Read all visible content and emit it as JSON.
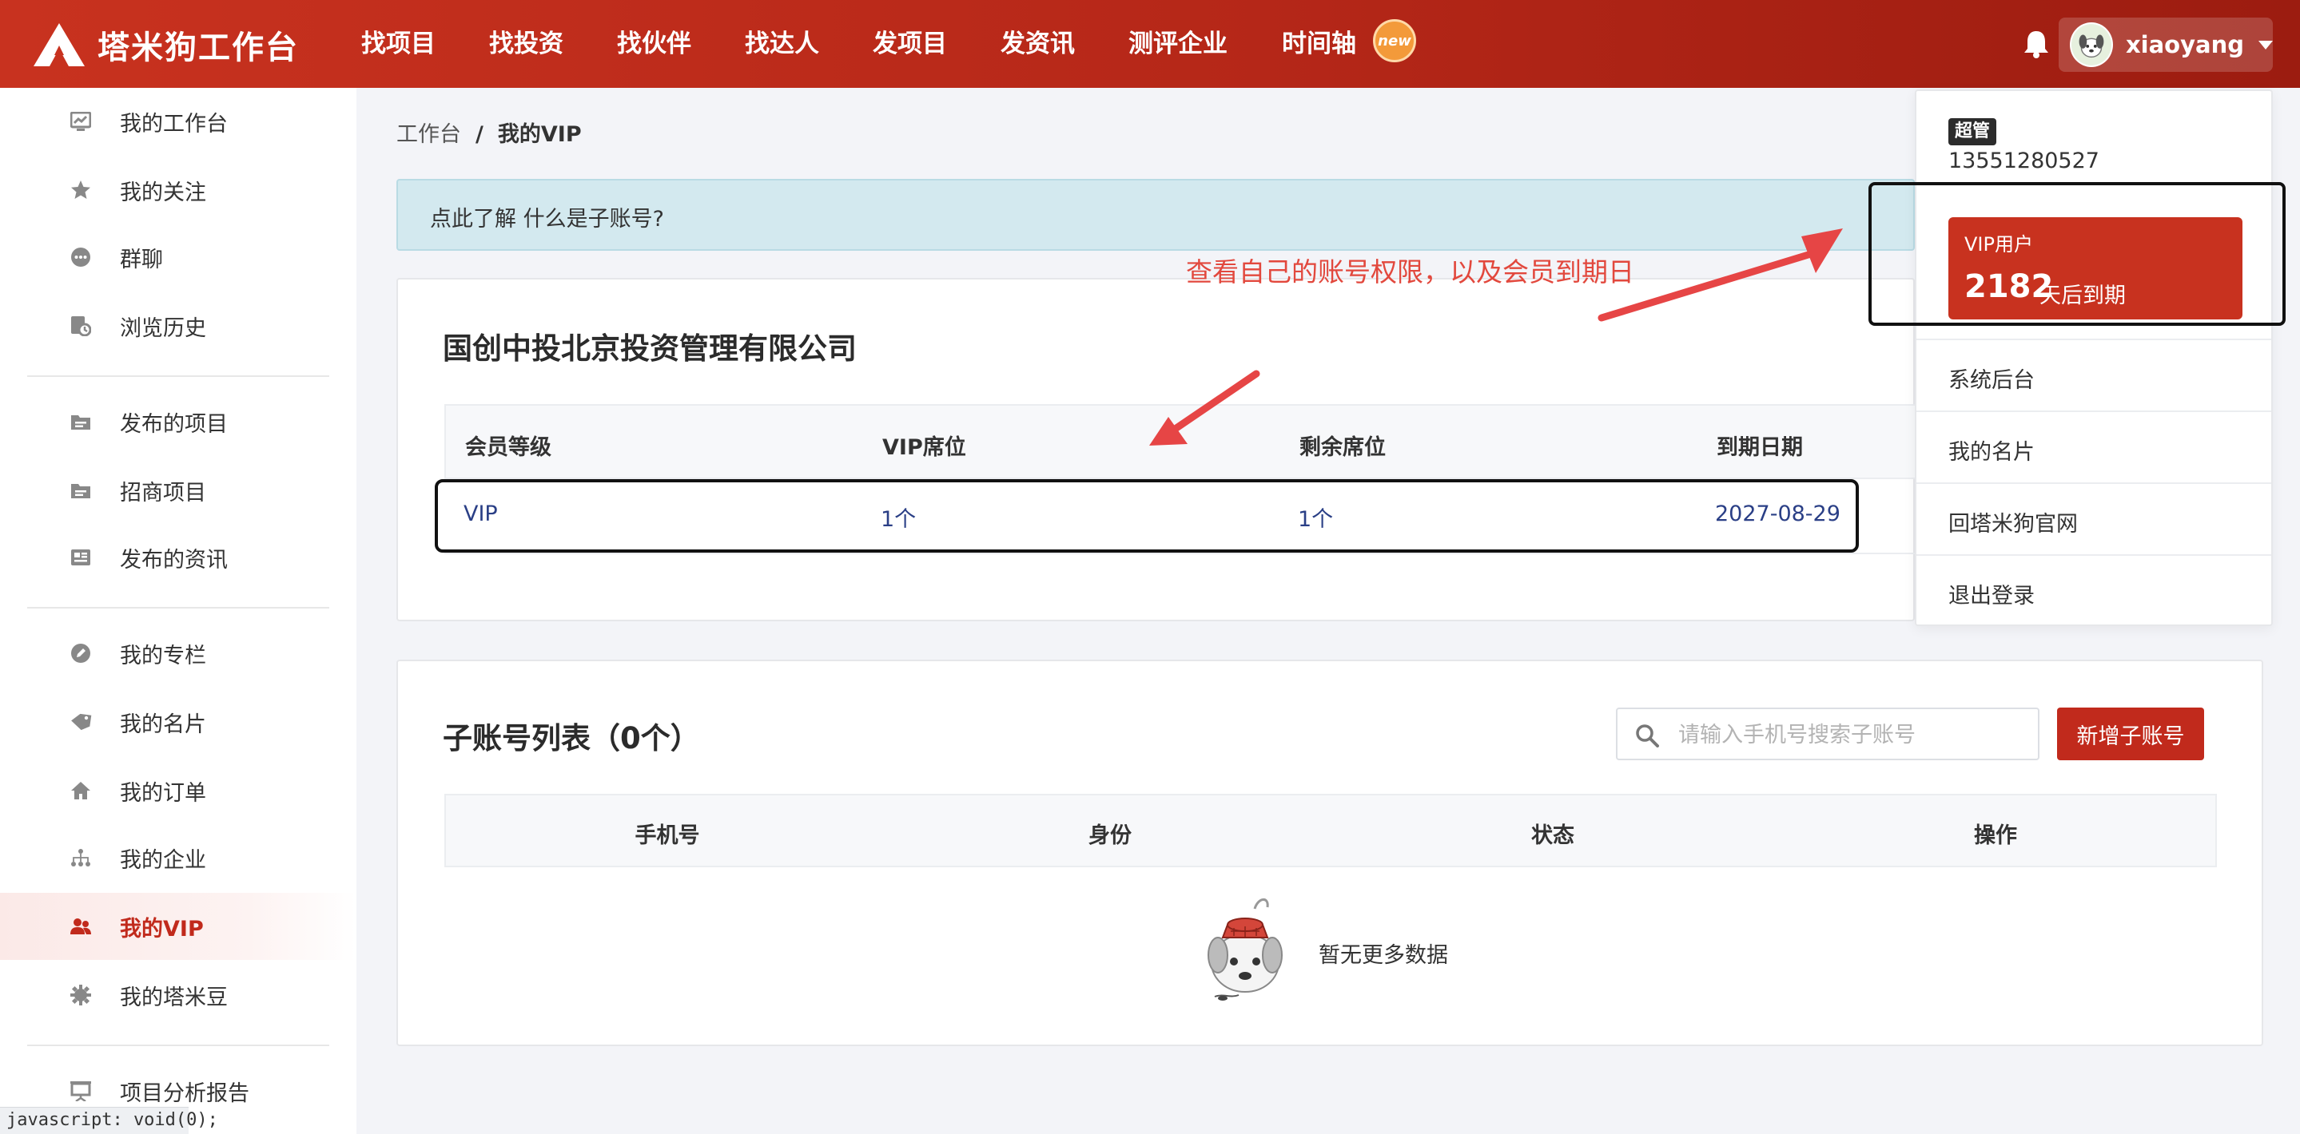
{
  "app": {
    "brand": "塔米狗工作台"
  },
  "nav": {
    "items": [
      "找项目",
      "找投资",
      "找伙伴",
      "找达人",
      "发项目",
      "发资讯",
      "测评企业",
      "时间轴"
    ],
    "new_badge": "new"
  },
  "user": {
    "name": "xiaoyang"
  },
  "sidebar": {
    "items": [
      {
        "label": "我的工作台",
        "icon": "dashboard-icon"
      },
      {
        "label": "我的关注",
        "icon": "star-icon"
      },
      {
        "label": "群聊",
        "icon": "chat-icon"
      },
      {
        "label": "浏览历史",
        "icon": "history-icon"
      },
      {
        "label": "发布的项目",
        "icon": "folder-icon"
      },
      {
        "label": "招商项目",
        "icon": "folder-icon"
      },
      {
        "label": "发布的资讯",
        "icon": "news-icon"
      },
      {
        "label": "我的专栏",
        "icon": "pen-icon"
      },
      {
        "label": "我的名片",
        "icon": "tag-icon"
      },
      {
        "label": "我的订单",
        "icon": "home-icon"
      },
      {
        "label": "我的企业",
        "icon": "org-icon"
      },
      {
        "label": "我的VIP",
        "icon": "users-icon"
      },
      {
        "label": "我的塔米豆",
        "icon": "gear-icon"
      },
      {
        "label": "项目分析报告",
        "icon": "presentation-icon"
      }
    ],
    "active": "我的VIP"
  },
  "statusbar": {
    "text": "javascript: void(0);"
  },
  "breadcrumb": {
    "first": "工作台",
    "separator": "/",
    "current": "我的VIP"
  },
  "info_bar": {
    "text": "点此了解 什么是子账号?"
  },
  "company": {
    "name": "国创中投北京投资管理有限公司",
    "headers": [
      "会员等级",
      "VIP席位",
      "剩余席位",
      "到期日期"
    ],
    "row": [
      "VIP",
      "1个",
      "1个",
      "2027-08-29"
    ]
  },
  "sub_accounts": {
    "title": "子账号列表（0个）",
    "search_placeholder": "请输入手机号搜索子账号",
    "add_button": "新增子账号",
    "headers": [
      "手机号",
      "身份",
      "状态",
      "操作"
    ],
    "empty_text": "暂无更多数据"
  },
  "dropdown": {
    "role": "超管",
    "phone": "13551280527",
    "vip_label": "VIP用户",
    "vip_days": "2182",
    "vip_suffix": "天后到期",
    "items": [
      "系统后台",
      "我的名片",
      "回塔米狗官网",
      "退出登录"
    ]
  },
  "annotation": {
    "text": "查看自己的账号权限，以及会员到期日"
  },
  "colors": {
    "brand_red": "#c8321f",
    "annotation_red": "#e2483d",
    "info_bg": "#d3e9ef",
    "link_blue": "#2a3f86"
  }
}
